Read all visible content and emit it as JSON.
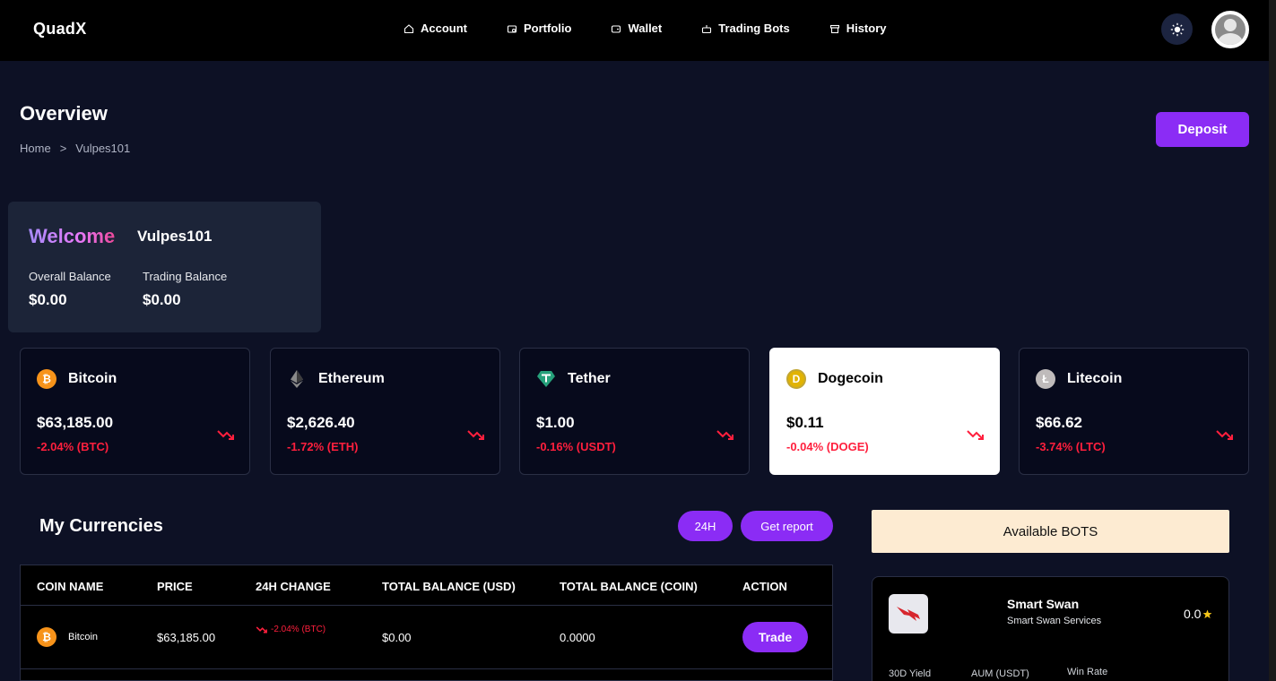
{
  "brand": {
    "logo_text": "QuadX"
  },
  "nav": {
    "items": [
      {
        "label": "Account",
        "icon": "home-icon"
      },
      {
        "label": "Portfolio",
        "icon": "portfolio-icon"
      },
      {
        "label": "Wallet",
        "icon": "wallet-icon"
      },
      {
        "label": "Trading Bots",
        "icon": "bot-icon"
      },
      {
        "label": "History",
        "icon": "archive-icon"
      }
    ],
    "theme_toggle_icon": "sun-icon",
    "avatar_icon": "user-avatar-icon"
  },
  "header": {
    "title": "Overview",
    "breadcrumb": {
      "home": "Home",
      "sep": ">",
      "current": "Vulpes101"
    },
    "deposit_label": "Deposit"
  },
  "welcome": {
    "greeting": "Welcome",
    "username": "Vulpes101",
    "overall_label": "Overall Balance",
    "overall_value": "$0.00",
    "trading_label": "Trading Balance",
    "trading_value": "$0.00"
  },
  "coins": [
    {
      "name": "Bitcoin",
      "price": "$63,185.00",
      "change": "-2.04% (BTC)",
      "icon": "bitcoin-icon",
      "color": "#f7931a",
      "glyph": "₿"
    },
    {
      "name": "Ethereum",
      "price": "$2,626.40",
      "change": "-1.72% (ETH)",
      "icon": "ethereum-icon",
      "color": "#627eea",
      "glyph": ""
    },
    {
      "name": "Tether",
      "price": "$1.00",
      "change": "-0.16% (USDT)",
      "icon": "tether-icon",
      "color": "#26a17b",
      "glyph": "T"
    },
    {
      "name": "Dogecoin",
      "price": "$0.11",
      "change": "-0.04% (DOGE)",
      "icon": "dogecoin-icon",
      "color": "#c2a633",
      "glyph": "D"
    },
    {
      "name": "Litecoin",
      "price": "$66.62",
      "change": "-3.74% (LTC)",
      "icon": "litecoin-icon",
      "color": "#bfbbbb",
      "glyph": "Ł"
    }
  ],
  "currencies": {
    "title": "My Currencies",
    "period_label": "24H",
    "report_label": "Get report",
    "columns": [
      "COIN NAME",
      "PRICE",
      "24H CHANGE",
      "TOTAL BALANCE (USD)",
      "TOTAL BALANCE (COIN)",
      "ACTION"
    ],
    "rows": [
      {
        "coin": "Bitcoin",
        "price": "$63,185.00",
        "change": "-2.04% (BTC)",
        "usd": "$0.00",
        "coin_balance": "0.0000",
        "action": "Trade"
      }
    ]
  },
  "bots": {
    "header": "Available BOTS",
    "items": [
      {
        "name": "Smart Swan",
        "provider": "Smart Swan Services",
        "rating": "0.0",
        "yield_label": "30D Yield",
        "aum_label": "AUM (USDT)",
        "winrate_label": "Win Rate"
      }
    ]
  },
  "colors": {
    "accent": "#8b2cf5",
    "negative": "#ff1f3d",
    "background": "#0d1125",
    "card": "#070a1c"
  }
}
